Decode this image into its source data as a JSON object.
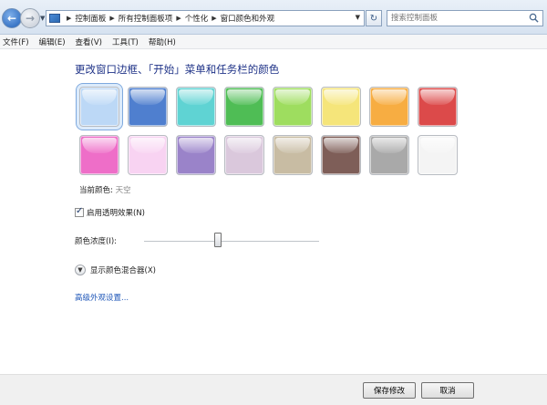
{
  "address": {
    "crumbs": [
      "控制面板",
      "所有控制面板项",
      "个性化",
      "窗口颜色和外观"
    ],
    "search_placeholder": "搜索控制面板"
  },
  "menu": [
    "文件(F)",
    "编辑(E)",
    "查看(V)",
    "工具(T)",
    "帮助(H)"
  ],
  "title": "更改窗口边框、「开始」菜单和任务栏的颜色",
  "swatches": [
    {
      "color": "#bcd8f6",
      "selected": true
    },
    {
      "color": "#4f7fcf"
    },
    {
      "color": "#5fd3d3"
    },
    {
      "color": "#4fbd55"
    },
    {
      "color": "#9edd5f"
    },
    {
      "color": "#f5e57a"
    },
    {
      "color": "#f7ad42"
    },
    {
      "color": "#dc4a4a"
    },
    {
      "color": "#ee6ec8"
    },
    {
      "color": "#f8d3f2"
    },
    {
      "color": "#9a83c9"
    },
    {
      "color": "#dac8dc"
    },
    {
      "color": "#c8bca3"
    },
    {
      "color": "#7e5e58"
    },
    {
      "color": "#a9a9a9"
    },
    {
      "color": "#f4f4f4"
    }
  ],
  "current_label": "当前颜色:",
  "current_value": "天空",
  "transparency_label": "启用透明效果(N)",
  "transparency_checked": true,
  "intensity_label": "颜色浓度(I):",
  "intensity_fraction": 0.42,
  "mixer_label": "显示颜色混合器(X)",
  "advanced_link": "高级外观设置...",
  "buttons": {
    "save": "保存修改",
    "cancel": "取消"
  }
}
